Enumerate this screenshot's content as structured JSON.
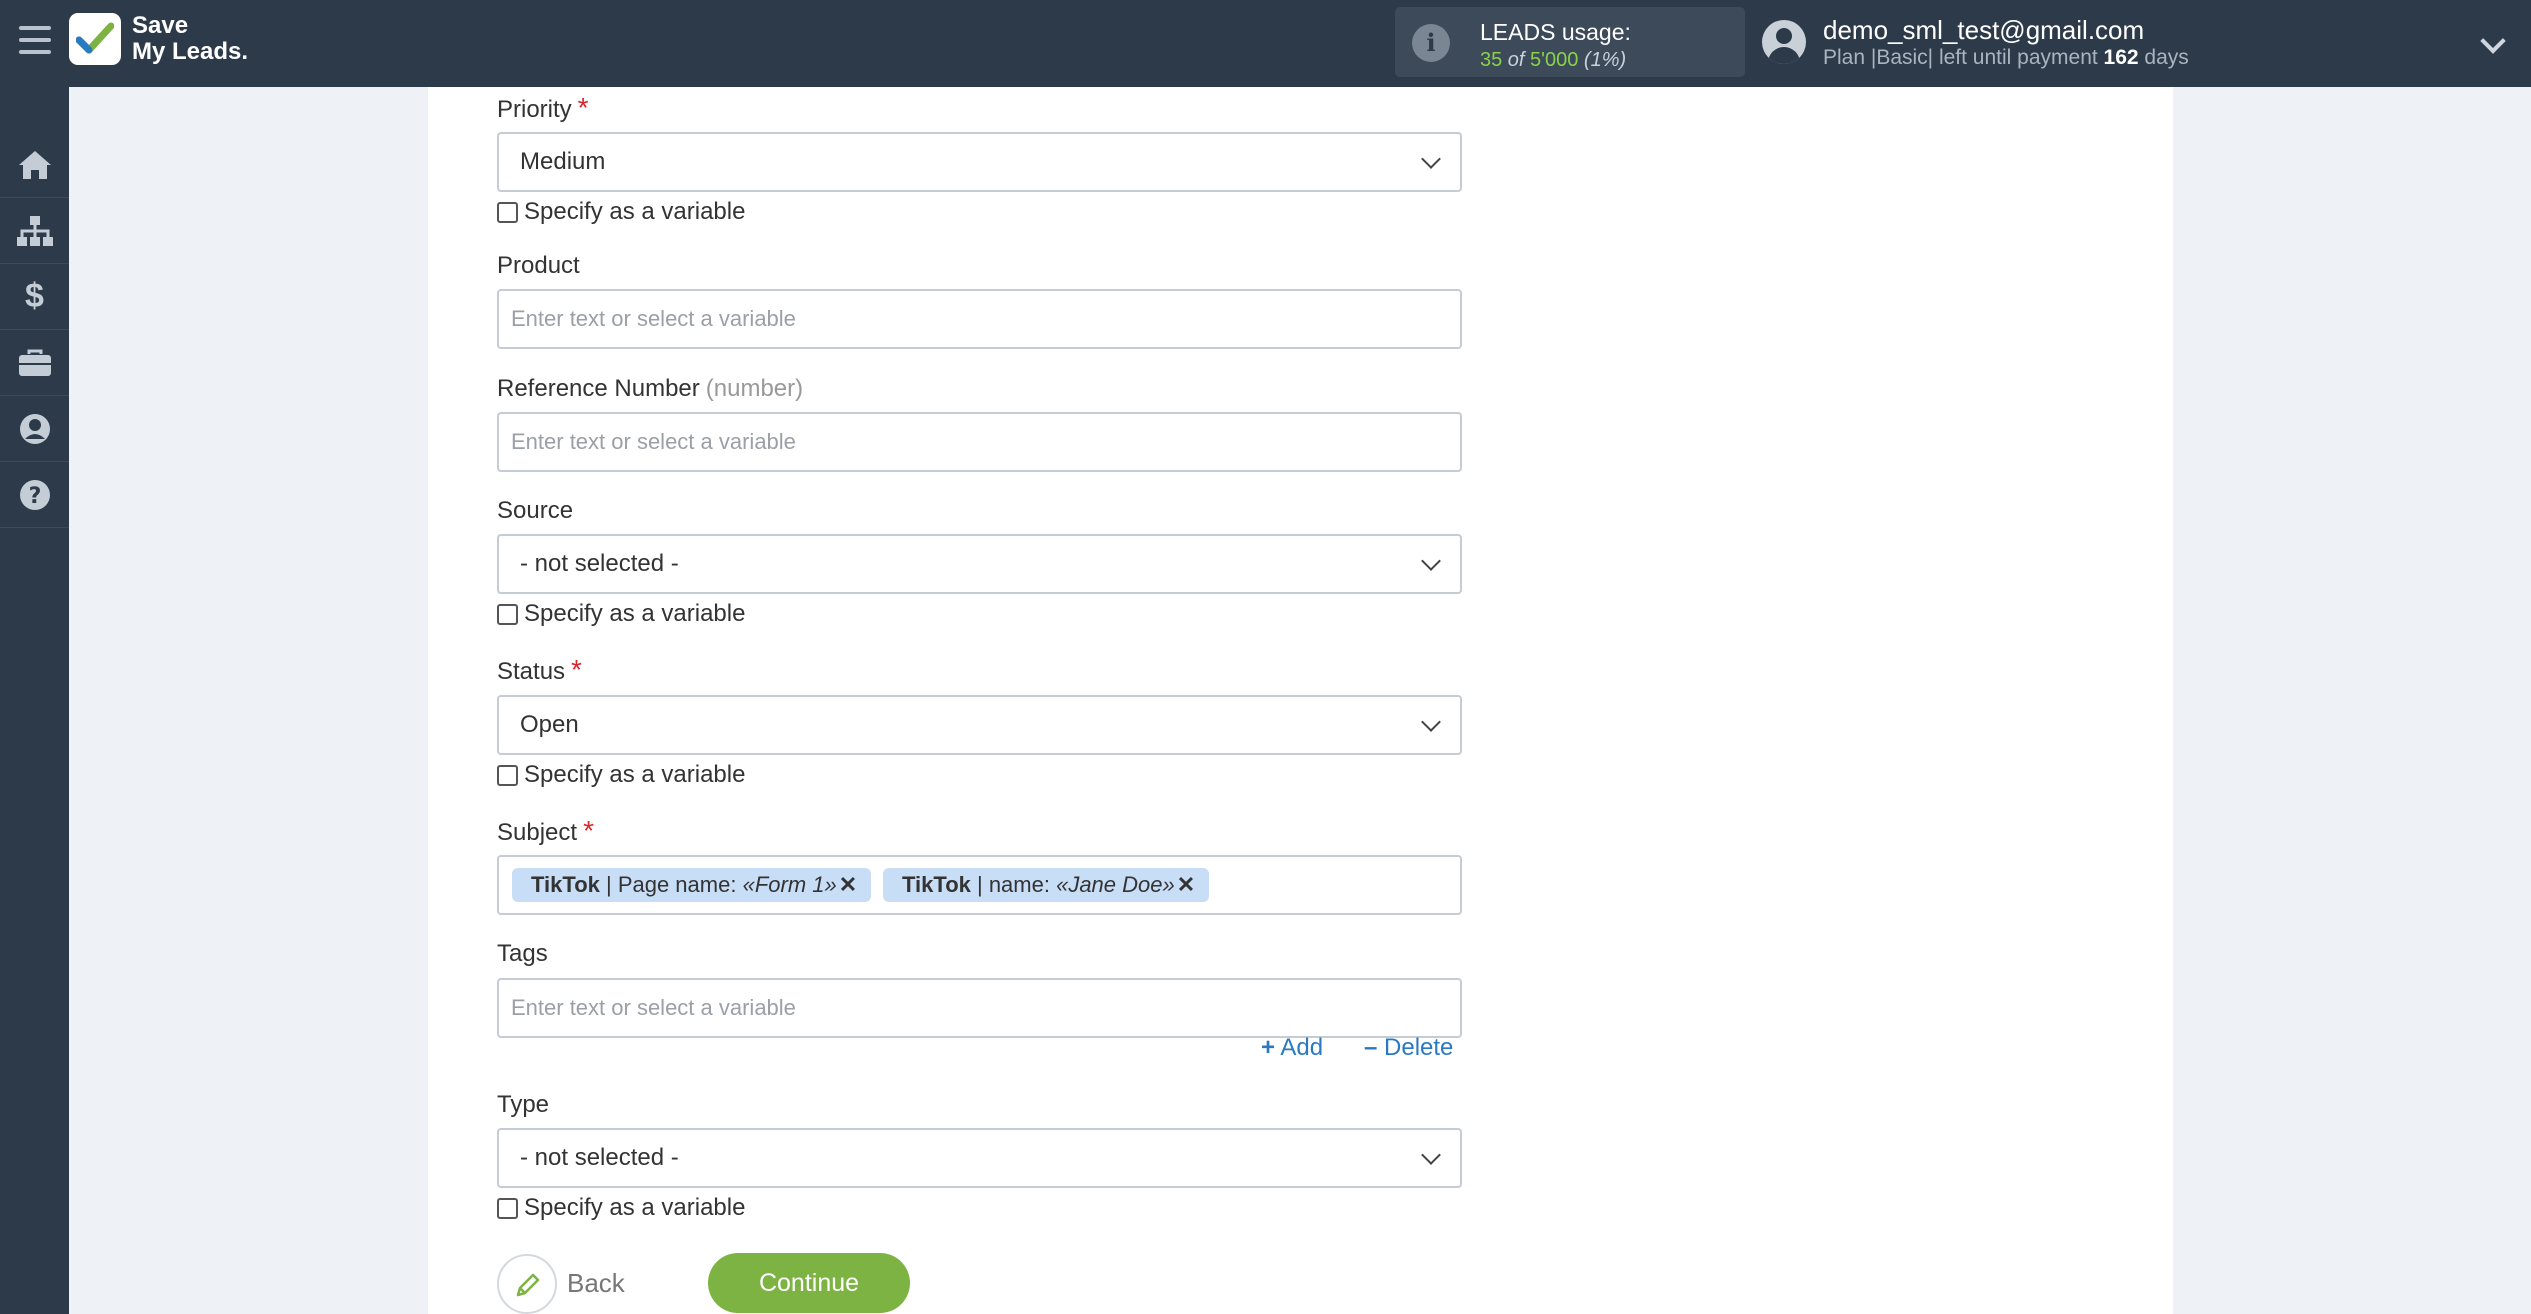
{
  "header": {
    "brand_line1": "Save",
    "brand_line2": "My Leads.",
    "usage_label": "LEADS usage:",
    "usage_used": "35",
    "usage_of": " of ",
    "usage_total": "5'000",
    "usage_percent": "(1%)",
    "user_email": "demo_sml_test@gmail.com",
    "plan_prefix": "Plan |Basic| left until payment ",
    "plan_days": "162",
    "plan_suffix": " days"
  },
  "sidebar": {
    "icons": [
      "home-icon",
      "sitemap-icon",
      "dollar-icon",
      "briefcase-icon",
      "user-circle-icon",
      "question-circle-icon"
    ]
  },
  "form": {
    "priority": {
      "label": "Priority",
      "value": "Medium",
      "specify": "Specify as a variable"
    },
    "product": {
      "label": "Product",
      "placeholder": "Enter text or select a variable"
    },
    "reference": {
      "label": "Reference Number",
      "hint": "(number)",
      "placeholder": "Enter text or select a variable"
    },
    "source": {
      "label": "Source",
      "value": "- not selected -",
      "specify": "Specify as a variable"
    },
    "status": {
      "label": "Status",
      "value": "Open",
      "specify": "Specify as a variable"
    },
    "subject": {
      "label": "Subject",
      "tags": [
        {
          "source": "TikTok",
          "field": " | Page name: ",
          "value": "«Form 1»"
        },
        {
          "source": "TikTok",
          "field": " | name: ",
          "value": "«Jane Doe»"
        }
      ]
    },
    "tags": {
      "label": "Tags",
      "placeholder": "Enter text or select a variable",
      "add": "Add",
      "delete": "Delete"
    },
    "type": {
      "label": "Type",
      "value": "- not selected -",
      "specify": "Specify as a variable"
    },
    "required_mark": "*"
  },
  "actions": {
    "back": "Back",
    "continue": "Continue"
  },
  "colors": {
    "topbar": "#2c3a4a",
    "accent_green": "#7cb342",
    "link_blue": "#2a7ac3",
    "tag_bg": "#c8ddf6",
    "required_red": "#d9262c"
  }
}
